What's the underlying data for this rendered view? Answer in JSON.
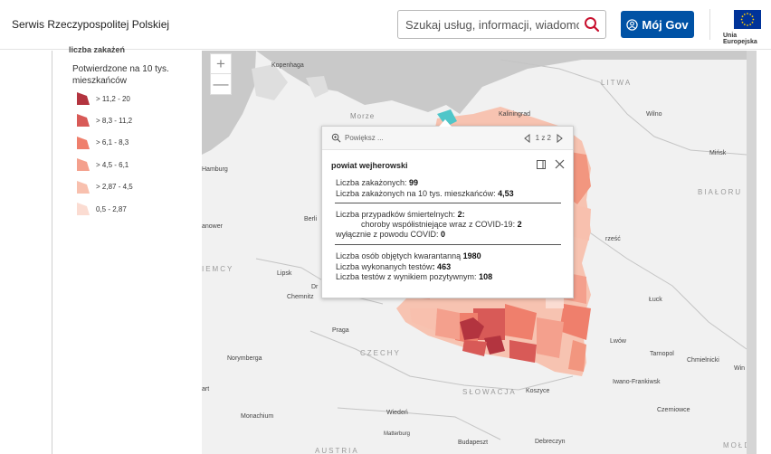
{
  "header": {
    "site_name": "Serwis Rzeczypospolitej Polskiej",
    "search_placeholder": "Szukaj usług, informacji, wiadomości",
    "mojgov_label": "Mój Gov",
    "eu_label": "Unia Europejska"
  },
  "legend": {
    "cut_heading": "liczba zakażeń",
    "title": "Potwierdzone na 10 tys. mieszkańców",
    "items": [
      {
        "label": "> 11,2 - 20",
        "color": "#b3343f"
      },
      {
        "label": "> 8,3 - 11,2",
        "color": "#d85a57"
      },
      {
        "label": "> 6,1 - 8,3",
        "color": "#ef7f6c"
      },
      {
        "label": "> 4,5 - 6,1",
        "color": "#f4a08d"
      },
      {
        "label": "> 2,87 - 4,5",
        "color": "#f8c0ae"
      },
      {
        "label": "0,5 - 2,87",
        "color": "#fbdcd2"
      }
    ]
  },
  "map": {
    "zoom_in": "+",
    "zoom_out": "—",
    "places": {
      "kopenhaga": "Kopenhaga",
      "kaliningrad": "Kaliningrad",
      "wilno": "Wilno",
      "mińsk": "Mińsk",
      "hamburg": "Hamburg",
      "berlin": "Berli",
      "hanower": "anower",
      "lipsk": "Lipsk",
      "chemnitz": "Chemnitz",
      "dr": "Dr",
      "praga": "Praga",
      "norymberga": "Norymberga",
      "art": "art",
      "monachium": "Monachium",
      "wiedeń": "Wiedeń",
      "matterburg": "Matterburg",
      "budapeszt": "Budapeszt",
      "debreczyn": "Debreczyn",
      "koszyce": "Koszyce",
      "łuck": "Łuck",
      "lwów": "Lwów",
      "tarnopol": "Tarnopol",
      "chmielnicki": "Chmielnicki",
      "win": "Win",
      "iwano": "Iwano-Frankiwsk",
      "czerniowce": "Czerniowce",
      "brzesc": "rześć"
    },
    "countries": {
      "litwa": "LITWA",
      "bialorus": "BIAŁORU",
      "niemcy": "IEMCY",
      "czechy": "CZECHY",
      "slowacja": "SŁOWACJA",
      "austria": "AUSTRIA",
      "moldova": "MOŁD"
    },
    "sea": "Morze"
  },
  "popup": {
    "zoom_label": "Powiększ ...",
    "pager": "1 z 2",
    "title": "powiat wejherowski",
    "cases_label": "Liczba zakażonych: ",
    "cases_value": "99",
    "cases10k_label": "Liczba zakażonych na 10 tys. mieszkańców: ",
    "cases10k_value": "4,53",
    "deaths_label": "Liczba przypadków śmiertelnych: ",
    "deaths_value": "2:",
    "comorb_label": "choroby współistniejące wraz z COVID-19: ",
    "comorb_value": "2",
    "covid_only_label": "wyłącznie z powodu COVID: ",
    "covid_only_value": "0",
    "quarantine_label": "Liczba osób objętych kwarantanną ",
    "quarantine_value": "1980",
    "tests_label": "Liczba wykonanych testów",
    "tests_value": ": 463",
    "positive_label": "Liczba testów z wynikiem pozytywnym: ",
    "positive_value": "108"
  }
}
